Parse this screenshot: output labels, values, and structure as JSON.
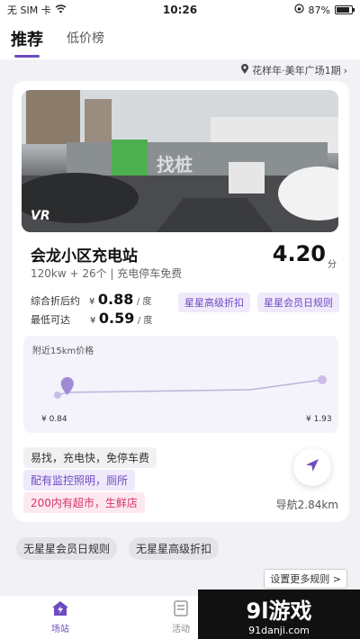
{
  "status_bar": {
    "carrier": "无 SIM 卡",
    "time": "10:26",
    "battery": "87%",
    "battery_level": 0.87
  },
  "tabs": [
    {
      "label": "推荐",
      "active": true
    },
    {
      "label": "低价榜",
      "active": false
    }
  ],
  "location": "花样年·美年广场1期",
  "station": {
    "photo_badge": "VR",
    "name": "会龙小区充电站",
    "price": "4.20",
    "price_unit": "分",
    "specs": "120kw + 26个 |   充电停车免费",
    "discount_label": "综合折后约",
    "discount_currency": "¥",
    "discount_value": "0.88",
    "discount_unit": "/ 度",
    "lowest_label": "最低可达",
    "lowest_currency": "¥",
    "lowest_value": "0.59",
    "lowest_unit": "/ 度",
    "tags": [
      "星星高级折扣",
      "星星会员日规则"
    ]
  },
  "chart_data": {
    "type": "line",
    "title": "附近15km价格",
    "x": [
      0.84,
      1.93
    ],
    "tick_labels": [
      "¥ 0.84",
      "¥ 1.93"
    ],
    "current_value": 0.88
  },
  "features": [
    "易找，充电快，免停车费",
    "配有监控照明，厕所",
    "200内有超市，生鲜店"
  ],
  "navigation": {
    "distance": "导航2.84km"
  },
  "rules": [
    "无星星会员日规则",
    "无星星高级折扣"
  ],
  "more_rules": "设置更多规则 >",
  "bottom_nav": [
    {
      "label": "场站",
      "active": true
    },
    {
      "label": "活动",
      "active": false
    }
  ],
  "watermark": {
    "logo": "9l游戏",
    "url": "91danji.com"
  },
  "colors": {
    "accent": "#6e4bc1",
    "pink": "#d6336c"
  }
}
